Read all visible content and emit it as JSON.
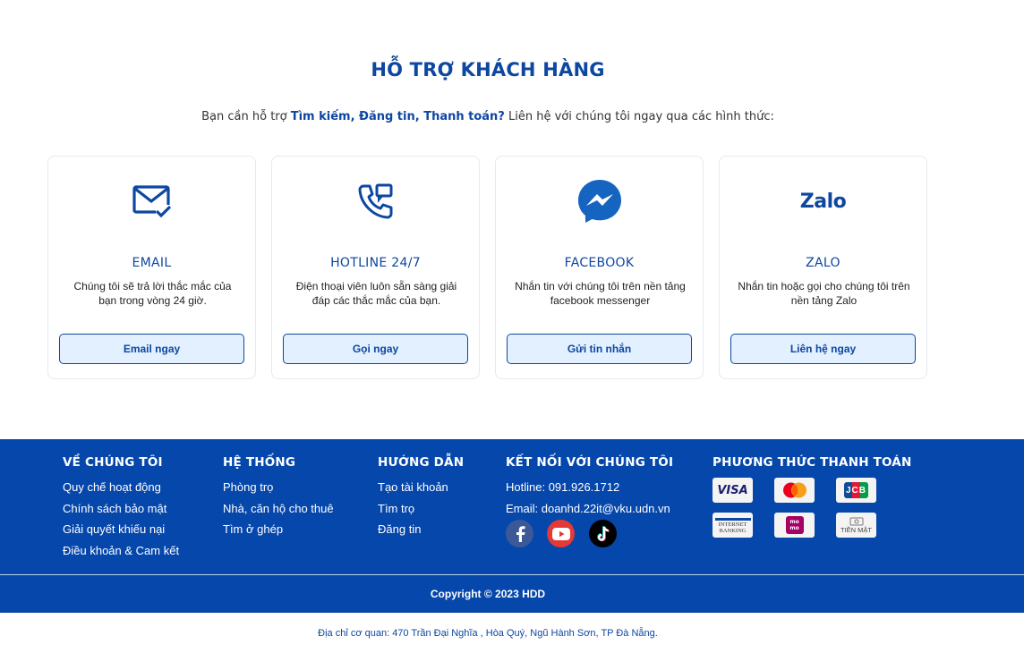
{
  "support": {
    "title": "HỖ TRỢ KHÁCH HÀNG",
    "subtitle_prefix": "Bạn cần hỗ trợ ",
    "subtitle_highlight": "Tìm kiếm, Đăng tin, Thanh toán?",
    "subtitle_suffix": " Liên hệ với chúng tôi ngay qua các hình thức:"
  },
  "cards": [
    {
      "icon": "email-icon",
      "title": "EMAIL",
      "desc": "Chúng tôi sẽ trả lời thắc mắc của bạn trong vòng 24 giờ.",
      "button": "Email ngay"
    },
    {
      "icon": "phone-icon",
      "title": "HOTLINE 24/7",
      "desc": "Điện thoại viên luôn sẵn sàng giải đáp các thắc mắc của bạn.",
      "button": "Gọi ngay"
    },
    {
      "icon": "messenger-icon",
      "title": "FACEBOOK",
      "desc": "Nhắn tin với chúng tôi trên nền tảng facebook messenger",
      "button": "Gửi tin nhắn"
    },
    {
      "icon": "zalo-icon",
      "icon_text": "Zalo",
      "title": "ZALO",
      "desc": "Nhắn tin hoặc gọi cho chúng tôi trên nền tảng Zalo",
      "button": "Liên hệ ngay"
    }
  ],
  "footer": {
    "about": {
      "heading": "VỀ CHÚNG TÔI",
      "links": [
        "Quy chế hoạt động",
        "Chính sách bảo mật",
        "Giải quyết khiếu nại",
        "Điều khoản & Cam kết"
      ]
    },
    "system": {
      "heading": "HỆ THỐNG",
      "links": [
        "Phòng trọ",
        "Nhà, căn hộ cho thuê",
        "Tìm ở ghép"
      ]
    },
    "guide": {
      "heading": "HƯỚNG DẪN",
      "links": [
        "Tạo tài khoản",
        "Tìm trọ",
        "Đăng tin"
      ]
    },
    "connect": {
      "heading": "KẾT NỐI VỚI CHÚNG TÔI",
      "hotline": "Hotline: 091.926.1712",
      "email": "Email: doanhd.22it@vku.udn.vn",
      "socials": [
        "facebook-icon",
        "youtube-icon",
        "tiktok-icon"
      ]
    },
    "payment": {
      "heading": "PHƯƠNG THỨC THANH TOÁN",
      "methods": [
        {
          "icon": "visa-icon",
          "text": "VISA"
        },
        {
          "icon": "mastercard-icon",
          "text": ""
        },
        {
          "icon": "jcb-icon",
          "text": "JCB"
        },
        {
          "icon": "internet-banking-icon",
          "text": "INTERNET BANKING"
        },
        {
          "icon": "momo-icon",
          "text": "mo mo"
        },
        {
          "icon": "cash-icon",
          "text": "TIỀN MẶT"
        }
      ]
    },
    "copyright": "Copyright © 2023 HDD"
  },
  "address": "Địa chỉ cơ quan: 470 Trần Đại Nghĩa , Hòa Quý, Ngũ Hành Sơn, TP Đà Nẵng.",
  "colors": {
    "primary": "#0d47a1",
    "footer_bg": "#0647ab",
    "button_bg": "#e3f0ff",
    "messenger": "#1565c0",
    "youtube": "#e53935",
    "tiktok": "#000000",
    "facebook": "#3b5998"
  }
}
